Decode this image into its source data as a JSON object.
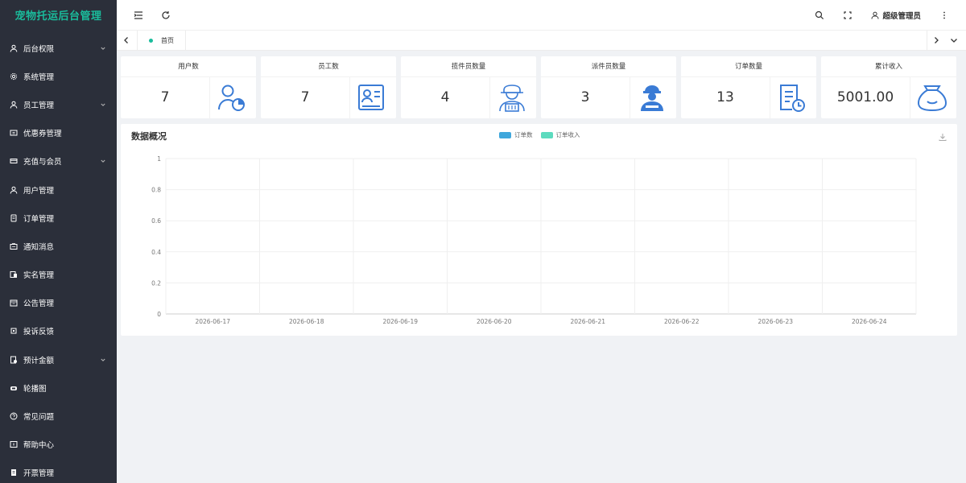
{
  "app": {
    "title": "宠物托运后台管理"
  },
  "sidebar": {
    "items": [
      {
        "label": "后台权限",
        "icon": "user-icon",
        "expandable": true
      },
      {
        "label": "系统管理",
        "icon": "gear-icon",
        "expandable": false
      },
      {
        "label": "员工管理",
        "icon": "user-icon",
        "expandable": true
      },
      {
        "label": "优惠券管理",
        "icon": "coupon-icon",
        "expandable": false
      },
      {
        "label": "充值与会员",
        "icon": "card-icon",
        "expandable": true
      },
      {
        "label": "用户管理",
        "icon": "user-icon",
        "expandable": false
      },
      {
        "label": "订单管理",
        "icon": "order-icon",
        "expandable": false
      },
      {
        "label": "通知消息",
        "icon": "notice-icon",
        "expandable": false
      },
      {
        "label": "实名管理",
        "icon": "id-icon",
        "expandable": false
      },
      {
        "label": "公告管理",
        "icon": "announce-icon",
        "expandable": false
      },
      {
        "label": "投诉反馈",
        "icon": "feedback-icon",
        "expandable": false
      },
      {
        "label": "预计金额",
        "icon": "money-icon",
        "expandable": true
      },
      {
        "label": "轮播图",
        "icon": "carousel-icon",
        "expandable": false
      },
      {
        "label": "常见问题",
        "icon": "question-icon",
        "expandable": false
      },
      {
        "label": "帮助中心",
        "icon": "help-icon",
        "expandable": false
      },
      {
        "label": "开票管理",
        "icon": "invoice-icon",
        "expandable": false
      }
    ]
  },
  "header": {
    "user_label": "超级管理员",
    "icons": [
      "menu-toggle-icon",
      "refresh-icon",
      "search-icon",
      "fullscreen-icon",
      "user-icon",
      "more-vertical-icon"
    ]
  },
  "tabs": {
    "home_label": "首页"
  },
  "stats": [
    {
      "title": "用户数",
      "value": "7",
      "icon": "user-chart-icon"
    },
    {
      "title": "员工数",
      "value": "7",
      "icon": "staff-card-icon"
    },
    {
      "title": "揽件员数量",
      "value": "4",
      "icon": "courier-icon"
    },
    {
      "title": "派件员数量",
      "value": "3",
      "icon": "delivery-man-icon"
    },
    {
      "title": "订单数量",
      "value": "13",
      "icon": "order-clock-icon"
    },
    {
      "title": "累计收入",
      "value": "5001.00",
      "icon": "money-bag-icon"
    }
  ],
  "colors": {
    "sidebar_bg": "#2b2f3a",
    "accent": "#1abc9c",
    "icon_blue": "#3a7bd5",
    "series_order_count": "#3fa7dc",
    "series_order_income": "#5cdbbe"
  },
  "panel": {
    "title": "数据概况"
  },
  "chart_data": {
    "type": "line",
    "title": "",
    "x": [
      "2026-06-17",
      "2026-06-18",
      "2026-06-19",
      "2026-06-20",
      "2026-06-21",
      "2026-06-22",
      "2026-06-23",
      "2026-06-24"
    ],
    "series": [
      {
        "name": "订单数",
        "values": []
      },
      {
        "name": "订单收入",
        "values": []
      }
    ],
    "y_ticks": [
      "0",
      "0.2",
      "0.4",
      "0.6",
      "0.8",
      "1"
    ],
    "ylim": [
      0,
      1
    ],
    "grid": true,
    "legend_position": "top-center"
  }
}
